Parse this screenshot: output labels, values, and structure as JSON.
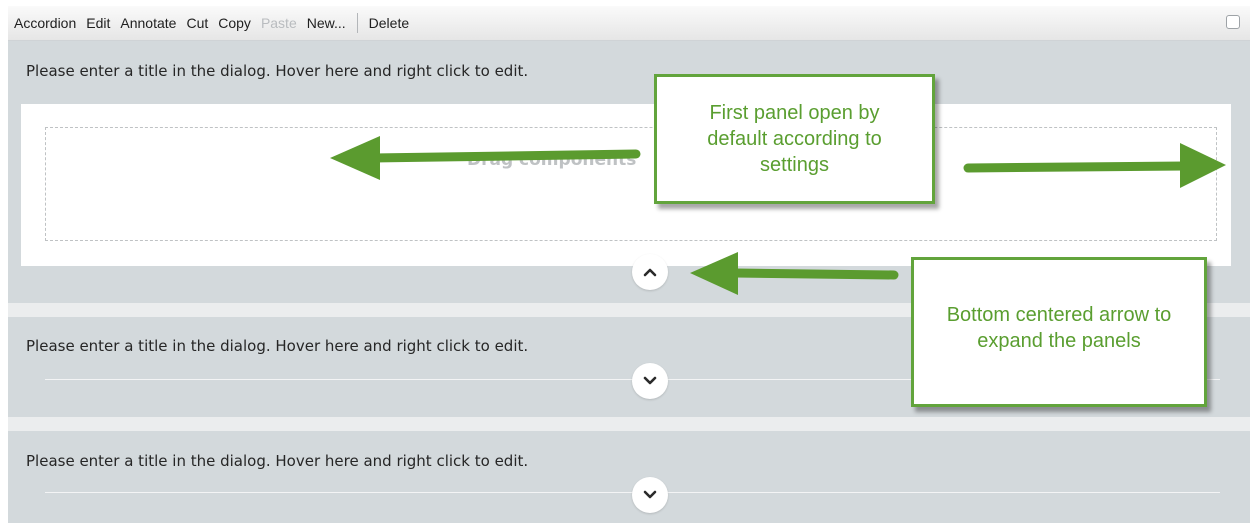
{
  "toolbar": {
    "items": [
      {
        "label": "Accordion",
        "disabled": false
      },
      {
        "label": "Edit",
        "disabled": false
      },
      {
        "label": "Annotate",
        "disabled": false
      },
      {
        "label": "Cut",
        "disabled": false
      },
      {
        "label": "Copy",
        "disabled": false
      },
      {
        "label": "Paste",
        "disabled": true
      },
      {
        "label": "New...",
        "disabled": false
      },
      {
        "label": "Delete",
        "disabled": false
      }
    ]
  },
  "panels": [
    {
      "title": "Please enter a title in the dialog. Hover here and right click to edit.",
      "expanded": true,
      "drop_text": "Drag components",
      "toggle_icon": "chevron-up-icon"
    },
    {
      "title": "Please enter a title in the dialog. Hover here and right click to edit.",
      "expanded": false,
      "toggle_icon": "chevron-down-icon"
    },
    {
      "title": "Please enter a title in the dialog. Hover here and right click to edit.",
      "expanded": false,
      "toggle_icon": "chevron-down-icon"
    }
  ],
  "annotations": {
    "callout_first_panel": {
      "lines": [
        "First panel open by",
        "default according to",
        "settings"
      ]
    },
    "callout_arrow": {
      "lines": [
        "Bottom centered arrow to",
        "expand the panels"
      ]
    },
    "accent_color": "#62a43c"
  },
  "colors": {
    "panel_bg": "#d3d9dc",
    "toolbar_bg": "#f0f0f0",
    "arrow_green": "#5b9b2f"
  }
}
